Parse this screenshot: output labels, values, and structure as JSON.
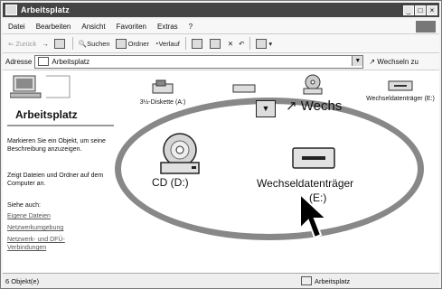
{
  "window": {
    "title": "Arbeitsplatz",
    "controls": [
      "_",
      "□",
      "×"
    ]
  },
  "menu": [
    "Datei",
    "Bearbeiten",
    "Ansicht",
    "Favoriten",
    "Extras",
    "?"
  ],
  "toolbar": {
    "back": "Zurück",
    "forward": "→",
    "search": "Suchen",
    "folders": "Ordner",
    "history": "Verlauf"
  },
  "address": {
    "label": "Adresse",
    "value": "Arbeitsplatz",
    "go": "Wechseln zu"
  },
  "leftpane": {
    "title": "Arbeitsplatz",
    "description": "Markieren Sie ein Objekt, um seine Beschreibung anzuzeigen.",
    "tip": "Zeigt Dateien und Ordner auf dem Computer an.",
    "see_also": "Siehe auch:",
    "links": [
      "Eigene Dateien",
      "Netzwerkumgebung",
      "Netzwerk- und DFÜ-Verbindungen"
    ]
  },
  "drives_row": {
    "floppy": "3½-Diskette (A:)",
    "removable_small": "Wechseldatenträger (E:)"
  },
  "zoom": {
    "go_text": "Wechs",
    "cd_label": "CD (D:)",
    "removable_label_1": "Wechseldatenträger",
    "removable_label_2": "(E:)"
  },
  "status": {
    "count": "6 Objekt(e)",
    "location": "Arbeitsplatz"
  }
}
